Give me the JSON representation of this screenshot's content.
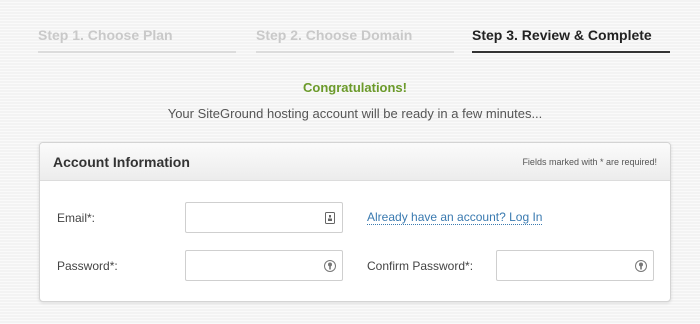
{
  "steps": [
    {
      "label": "Step 1. Choose Plan",
      "state": "inactive"
    },
    {
      "label": "Step 2. Choose Domain",
      "state": "inactive"
    },
    {
      "label": "Step 3. Review & Complete",
      "state": "active"
    }
  ],
  "messages": {
    "congrats": "Congratulations!",
    "ready": "Your SiteGround hosting account will be ready in a few minutes..."
  },
  "account": {
    "title": "Account Information",
    "required_note": "Fields marked with * are required!",
    "email_label": "Email*:",
    "email_value": "",
    "password_label": "Password*:",
    "password_value": "",
    "confirm_label": "Confirm Password*:",
    "confirm_value": "",
    "login_link": "Already have an account? Log In",
    "email_icon": "contact-card-icon",
    "password_icon": "key-icon"
  },
  "colors": {
    "accent_green": "#6b9a2a",
    "link_blue": "#3a7ab0",
    "active_step": "#222222",
    "inactive_step": "#c9c9c9"
  }
}
